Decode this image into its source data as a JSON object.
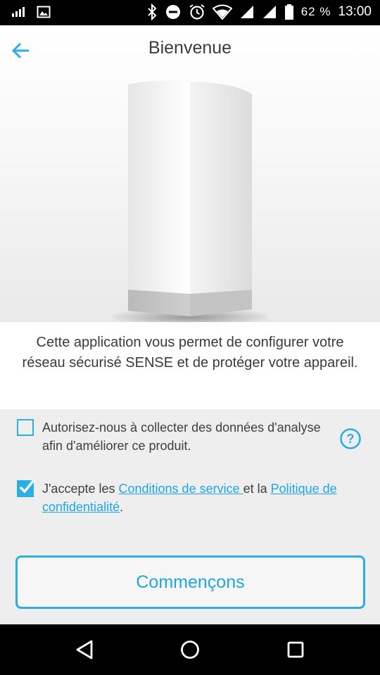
{
  "status_bar": {
    "battery_percent": "62 %",
    "time": "13:00",
    "icons": [
      "signal-bars-icon",
      "image-notification-icon",
      "bluetooth-icon",
      "do-not-disturb-icon",
      "alarm-icon",
      "wifi-icon",
      "cell-signal-icon",
      "cell-signal-icon",
      "battery-icon"
    ]
  },
  "header": {
    "title": "Bienvenue",
    "back_icon": "arrow-left-icon"
  },
  "description": "Cette application vous permet de configurer votre réseau sécurisé SENSE et de protéger votre appareil.",
  "options": {
    "analytics": {
      "label": "Autorisez-nous à collecter des données d'analyse afin d'améliorer ce produit.",
      "checked": false,
      "help_icon": "question-circle-icon"
    },
    "terms": {
      "prefix": "J'accepte les ",
      "terms_link": "Conditions de service ",
      "middle": "et la ",
      "privacy_link": "Politique de confidentialité",
      "suffix": ".",
      "checked": true
    }
  },
  "start_button": "Commençons",
  "navigation": {
    "back": "triangle-back-icon",
    "home": "circle-home-icon",
    "recents": "square-recents-icon"
  },
  "colors": {
    "accent": "#29aee6",
    "options_background": "#eeeeee"
  }
}
